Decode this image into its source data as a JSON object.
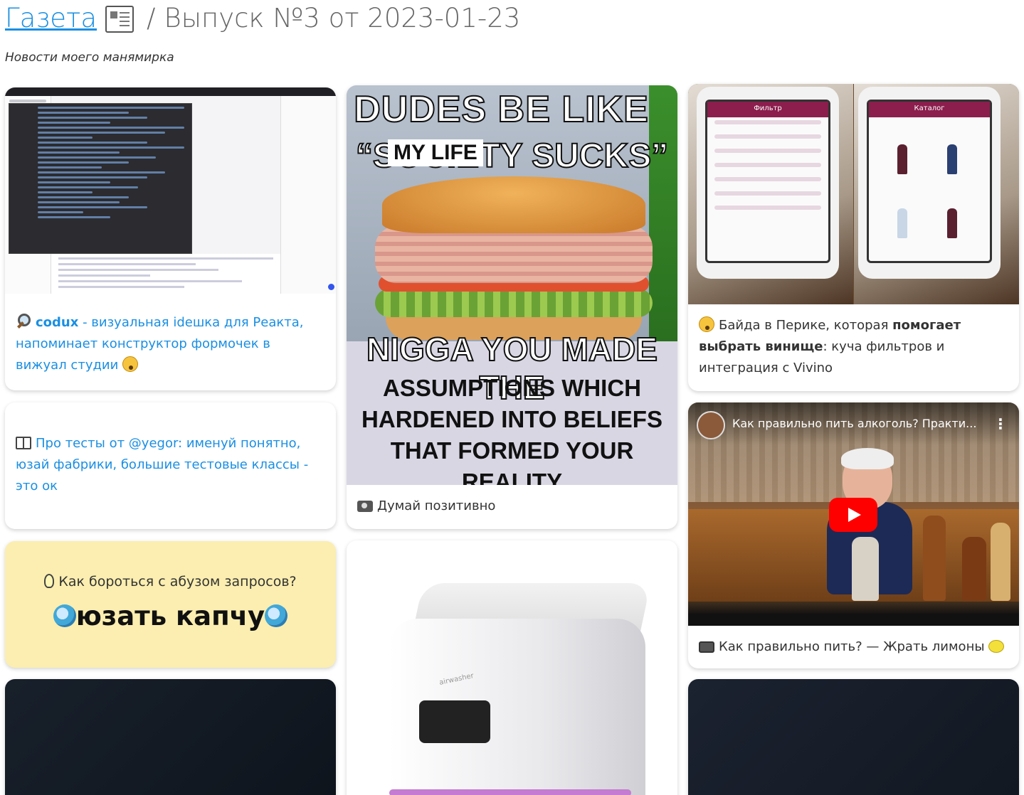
{
  "header": {
    "home_link": "Газета",
    "separator": "/",
    "issue": "Выпуск №3 от 2023-01-23"
  },
  "subtitle": "Новости моего манямирка",
  "cards": {
    "codux": {
      "name": "codux",
      "text": " - визуальная idешка для Реакта, напоминает конструктор формочек в вижуал студии"
    },
    "tests": {
      "text": "Про тесты от @yegor: именуй понятно, юзай фабрики, большие тестовые классы - это ок"
    },
    "captcha": {
      "question": "Как бороться с абузом запросов?",
      "answer": "юзать капчу"
    },
    "meme": {
      "line1": "DUDES BE LIKE",
      "line2": "“SOCIETY SUCKS”",
      "overlay": "MY LIFE",
      "line3": "NIGGA YOU MADE THE",
      "line4": "ASSUMPTIONS WHICH HARDENED INTO BELIEFS THAT FORMED YOUR REALITY",
      "caption": "Думай позитивно"
    },
    "wine": {
      "text_before": "Байда в Перике, которая ",
      "text_bold": "помогает выбрать винище",
      "text_after": ": куча фильтров и интеграция с Vivino",
      "screen_left_title": "Фильтр",
      "screen_right_title": "Каталог"
    },
    "video": {
      "title": "Как правильно пить алкоголь? Практи...",
      "caption": "Как правильно пить? — Жрать лимоны"
    },
    "airwasher": {
      "brand": "airwasher"
    }
  },
  "icons": {
    "paper": "newspaper-icon",
    "magnifier": "magnifier-icon",
    "book": "book-icon",
    "camera": "camera-icon",
    "tv": "tv-icon",
    "bulb": "lightbulb-icon",
    "face": "upside-down-face-icon",
    "surprised": "surprised-face-icon",
    "lemon": "lemon-icon",
    "wave": "waving-hand-icon"
  },
  "colors": {
    "link": "#1a8fe3",
    "captcha_bg": "#fbeeb0",
    "play_button": "#ff0000"
  }
}
